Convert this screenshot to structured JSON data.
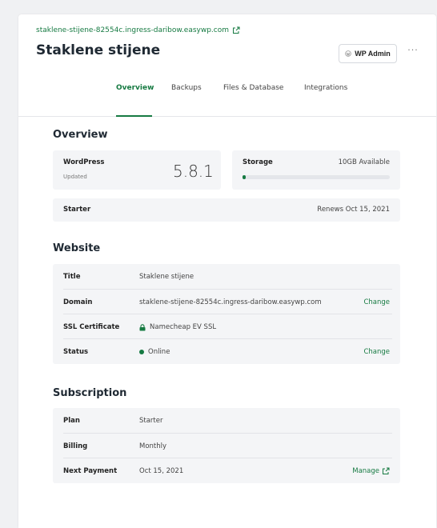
{
  "site": {
    "url": "staklene-stijene-82554c.ingress-daribow.easywp.com",
    "title": "Staklene stijene",
    "wp_admin_label": "WP Admin",
    "more_label": "···"
  },
  "tabs": [
    {
      "label": "Overview",
      "active": true
    },
    {
      "label": "Backups",
      "active": false
    },
    {
      "label": "Files & Database",
      "active": false
    },
    {
      "label": "Integrations",
      "active": false
    }
  ],
  "overview": {
    "heading": "Overview",
    "wordpress": {
      "label": "WordPress",
      "status": "Updated",
      "version": "5.8.1"
    },
    "storage": {
      "label": "Storage",
      "available": "10GB Available",
      "used_fraction": 0.01
    },
    "plan": {
      "label": "Starter",
      "renews": "Renews Oct 15, 2021"
    }
  },
  "website": {
    "heading": "Website",
    "rows": [
      {
        "label": "Title",
        "value": "Staklene stijene",
        "action": ""
      },
      {
        "label": "Domain",
        "value": "staklene-stijene-82554c.ingress-daribow.easywp.com",
        "action": "Change"
      },
      {
        "label": "SSL Certificate",
        "value": "Namecheap EV SSL",
        "action": ""
      },
      {
        "label": "Status",
        "value": "Online",
        "action": "Change"
      }
    ]
  },
  "subscription": {
    "heading": "Subscription",
    "rows": [
      {
        "label": "Plan",
        "value": "Starter",
        "action": ""
      },
      {
        "label": "Billing",
        "value": "Monthly",
        "action": ""
      },
      {
        "label": "Next Payment",
        "value": "Oct 15, 2021",
        "action": "Manage"
      }
    ]
  },
  "colors": {
    "accent": "#167a42",
    "panel": "#f4f5f7",
    "background": "#f0f1f3"
  }
}
